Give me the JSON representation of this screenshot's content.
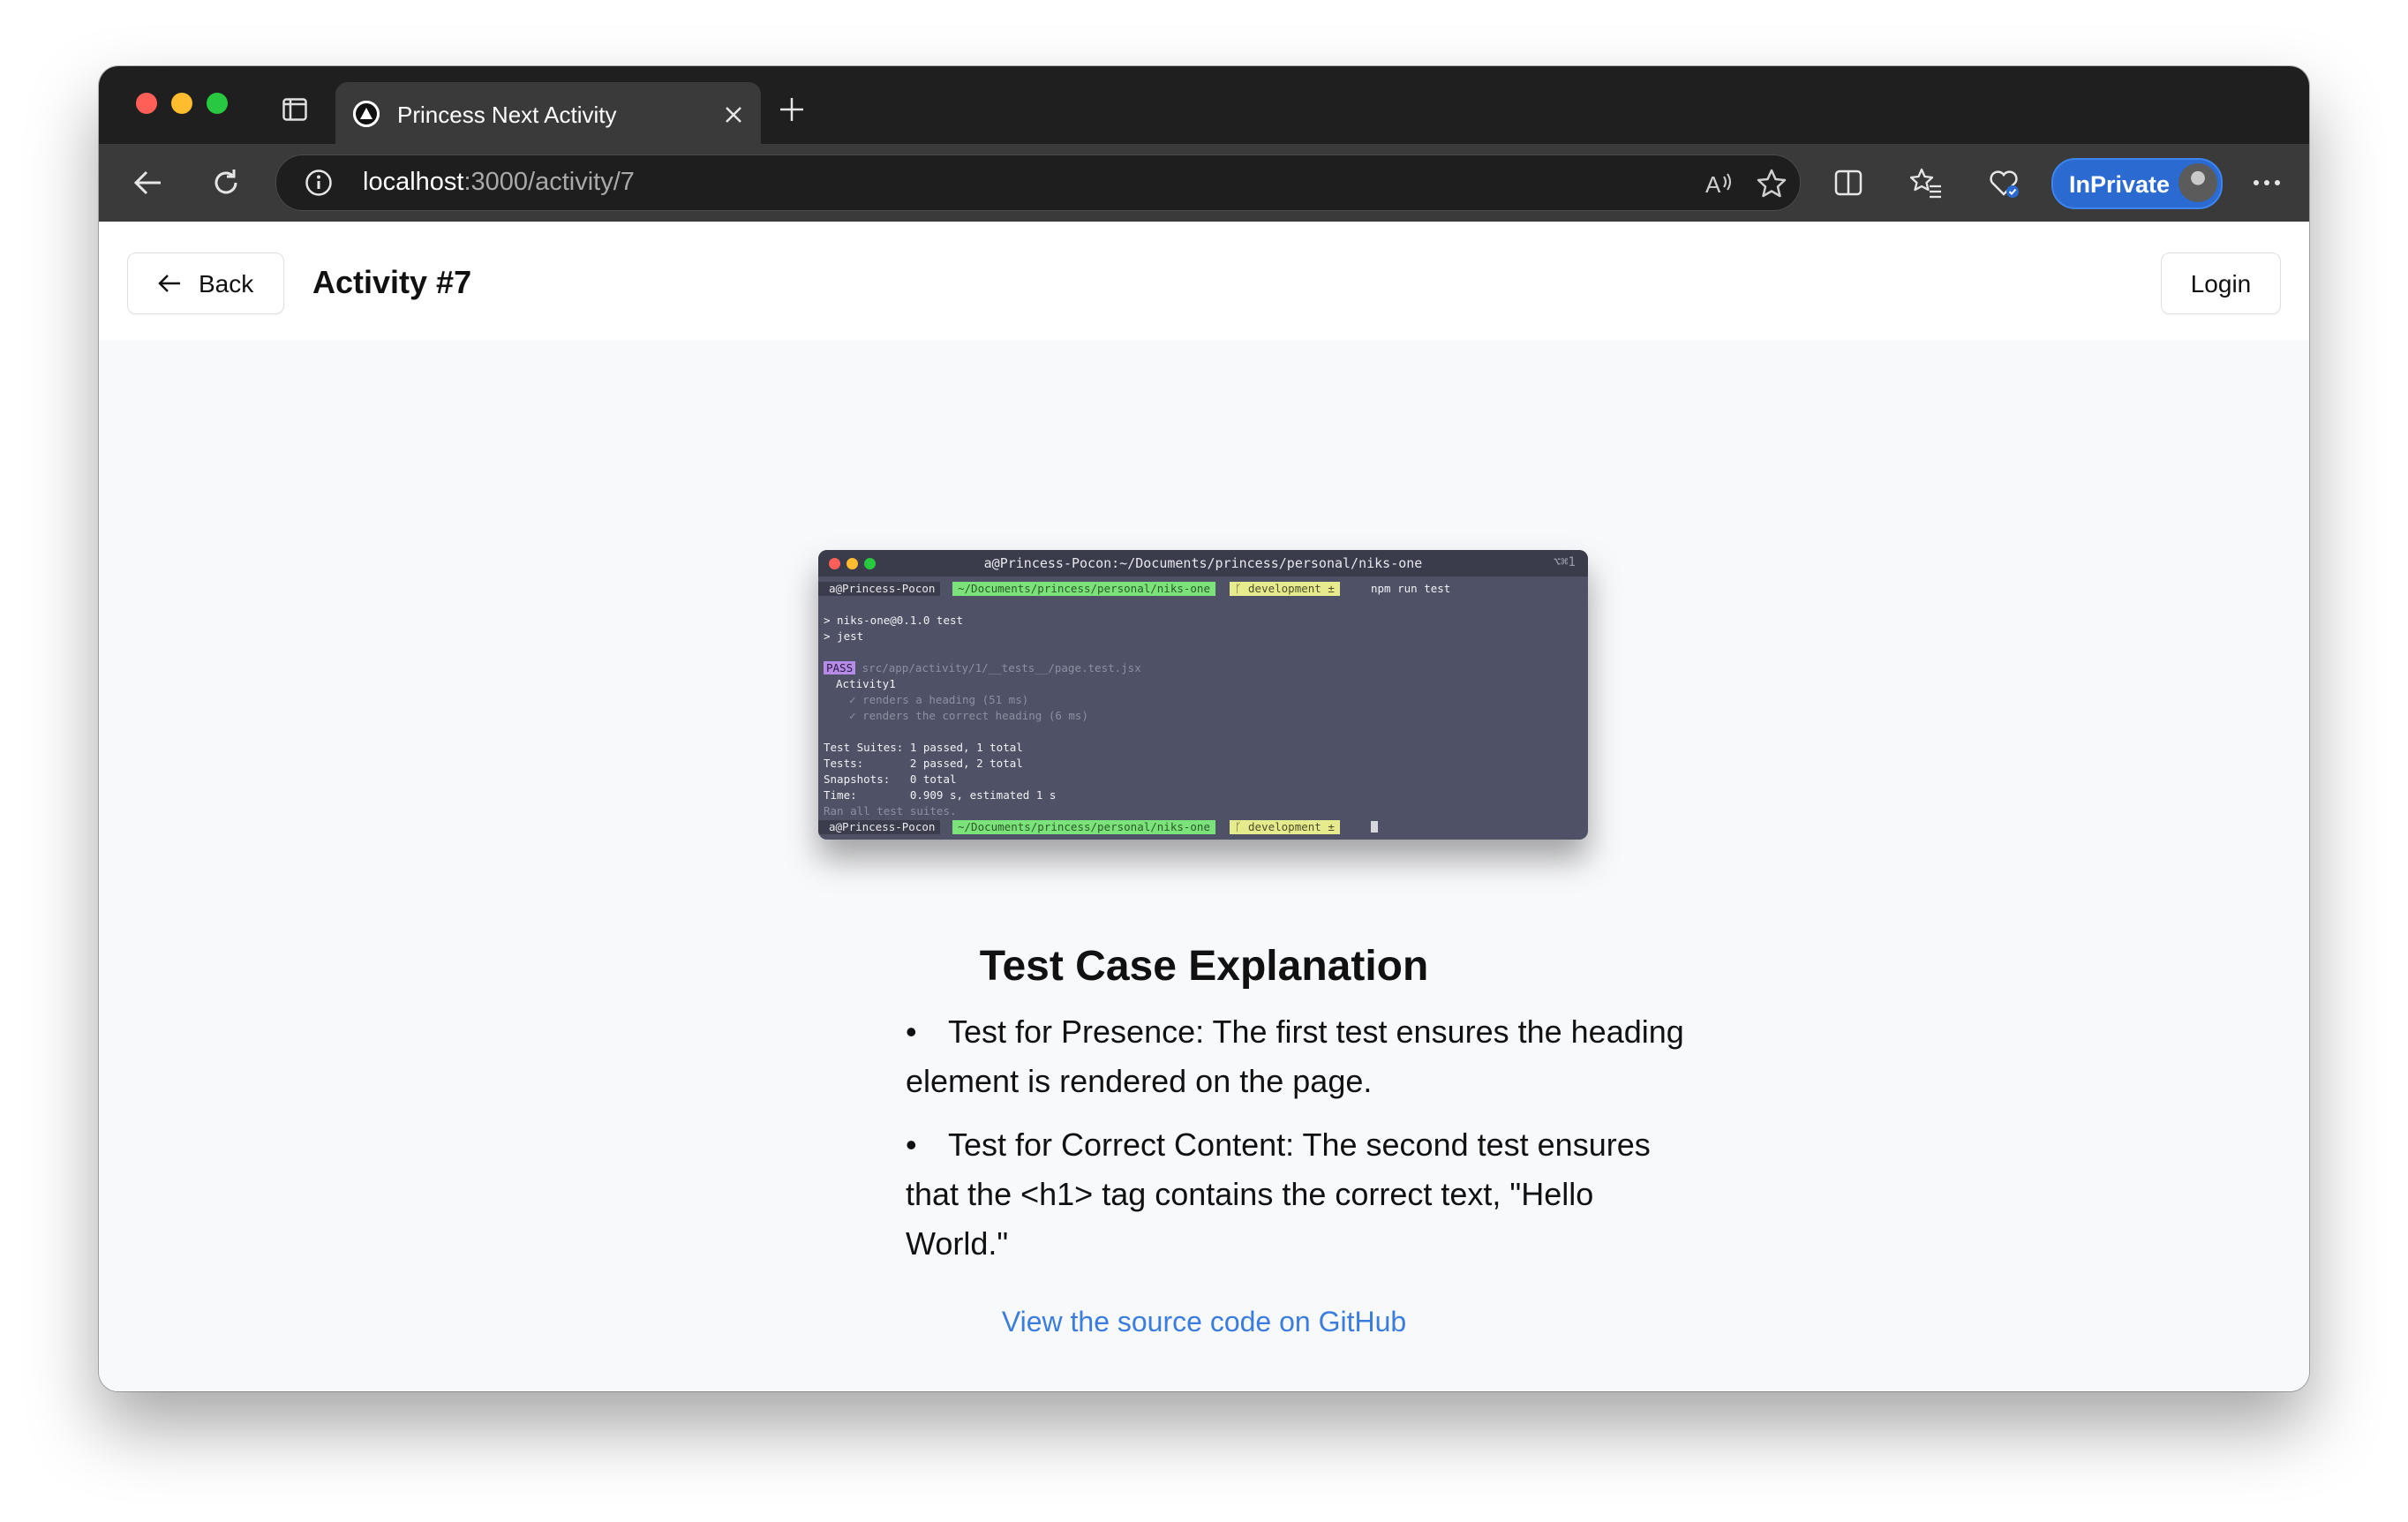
{
  "browser": {
    "tab_title": "Princess Next Activity",
    "url_host": "localhost",
    "url_path": ":3000/activity/7",
    "inprivate_label": "InPrivate"
  },
  "header": {
    "back_label": "Back",
    "title": "Activity #7",
    "login_label": "Login"
  },
  "terminal": {
    "title": "a@Princess-Pocon:~/Documents/princess/personal/niks-one",
    "shortcut": "⌥⌘1",
    "prompt_host": "a@Princess-Pocon",
    "prompt_path": "~/Documents/princess/personal/niks-one",
    "prompt_branch": "development",
    "command": "npm run test",
    "lines": [
      "> niks-one@0.1.0 test",
      "> jest",
      "src/app/activity/1/__tests__/page.test.jsx",
      "Activity1",
      "  ✓ renders a heading (51 ms)",
      "  ✓ renders the correct heading (6 ms)",
      "Test Suites: 1 passed, 1 total",
      "Tests:       2 passed, 2 total",
      "Snapshots:   0 total",
      "Time:        0.909 s, estimated 1 s",
      "Ran all test suites."
    ],
    "pass_label": "PASS"
  },
  "article": {
    "heading": "Test Case Explanation",
    "bullets": [
      "Test for Presence: The first test ensures the heading element is rendered on the page.",
      "Test for Correct Content: The second test ensures that the <h1> tag contains the correct text, \"Hello World.\""
    ],
    "link_text": "View the source code on GitHub"
  },
  "colors": {
    "accent_link": "#3b7ddd",
    "inprivate": "#2a6ad1",
    "page_bg": "#f8f9fb"
  }
}
